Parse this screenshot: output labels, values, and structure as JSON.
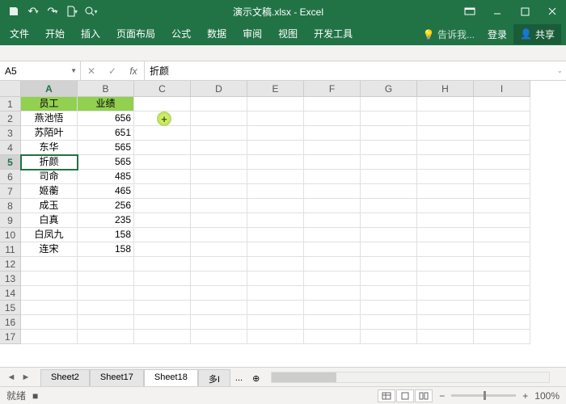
{
  "title": "演示文稿.xlsx - Excel",
  "ribbon_tabs": [
    "文件",
    "开始",
    "插入",
    "页面布局",
    "公式",
    "数据",
    "审阅",
    "视图",
    "开发工具"
  ],
  "tellme": "告诉我...",
  "signin": "登录",
  "share": "共享",
  "namebox": "A5",
  "formula": "折颜",
  "cols": [
    "A",
    "B",
    "C",
    "D",
    "E",
    "F",
    "G",
    "H",
    "I"
  ],
  "sel_col": 0,
  "rows": [
    1,
    2,
    3,
    4,
    5,
    6,
    7,
    8,
    9,
    10,
    11,
    12,
    13,
    14,
    15,
    16,
    17
  ],
  "sel_row": 5,
  "headers": [
    "员工",
    "业绩"
  ],
  "data": [
    {
      "a": "燕池悟",
      "b": "656"
    },
    {
      "a": "苏陌叶",
      "b": "651"
    },
    {
      "a": "东华",
      "b": "565"
    },
    {
      "a": "折颜",
      "b": "565"
    },
    {
      "a": "司命",
      "b": "485"
    },
    {
      "a": "姬蘅",
      "b": "465"
    },
    {
      "a": "成玉",
      "b": "256"
    },
    {
      "a": "白真",
      "b": "235"
    },
    {
      "a": "白凤九",
      "b": "158"
    },
    {
      "a": "连宋",
      "b": "158"
    }
  ],
  "sheets": [
    "Sheet2",
    "Sheet17",
    "Sheet18",
    "多I"
  ],
  "active_sheet": 2,
  "more": "...",
  "add": "⊕",
  "status": "就绪",
  "rec": "■",
  "zoom_minus": "−",
  "zoom_plus": "+",
  "zoom": "100%",
  "chart_data": {
    "type": "table",
    "title": "",
    "columns": [
      "员工",
      "业绩"
    ],
    "rows": [
      [
        "燕池悟",
        656
      ],
      [
        "苏陌叶",
        651
      ],
      [
        "东华",
        565
      ],
      [
        "折颜",
        565
      ],
      [
        "司命",
        485
      ],
      [
        "姬蘅",
        465
      ],
      [
        "成玉",
        256
      ],
      [
        "白真",
        235
      ],
      [
        "白凤九",
        158
      ],
      [
        "连宋",
        158
      ]
    ]
  }
}
